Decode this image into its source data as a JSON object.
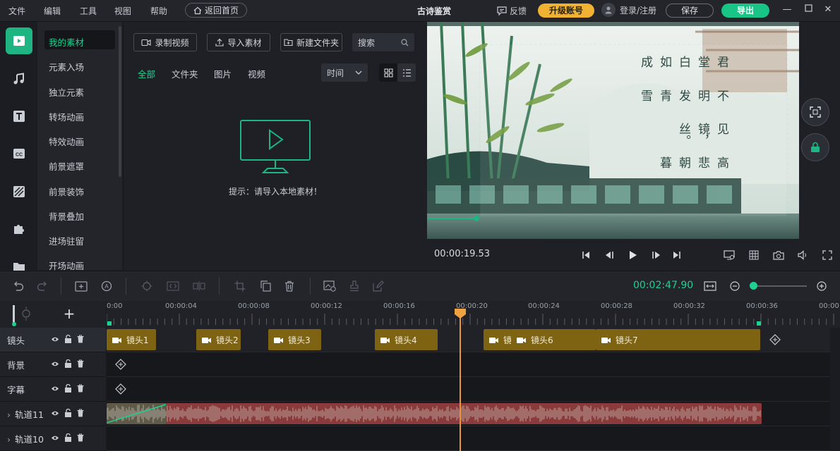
{
  "menu": [
    "文件",
    "编辑",
    "工具",
    "视图",
    "帮助"
  ],
  "home_button": "返回首页",
  "app_title": "古诗鉴赏",
  "feedback": "反馈",
  "upgrade": "升级账号",
  "login": "登录/注册",
  "save": "保存",
  "export": "导出",
  "categories": [
    "我的素材",
    "元素入场",
    "独立元素",
    "转场动画",
    "特效动画",
    "前景遮罩",
    "前景装饰",
    "背景叠加",
    "进场驻留",
    "开场动画"
  ],
  "media_toolbar": {
    "record": "录制视频",
    "import": "导入素材",
    "new_folder": "新建文件夹",
    "search_placeholder": "搜索"
  },
  "filter_tabs": [
    "全部",
    "文件夹",
    "图片",
    "视频"
  ],
  "sort": "时间",
  "empty_hint": "提示：请导入本地素材！",
  "preview": {
    "current_time": "00:00:19.53",
    "poem_columns": [
      "高悲朝暮",
      "见镜，丝。",
      "不明发青雪",
      "君堂白如成"
    ]
  },
  "total_time": "00:02:47.90",
  "ruler_ticks": [
    "0:00",
    "00:00:04",
    "00:00:08",
    "00:00:12",
    "00:00:16",
    "00:00:20",
    "00:00:24",
    "00:00:28",
    "00:00:32",
    "00:00:36",
    "00:00:"
  ],
  "tracks": [
    "镜头",
    "背景",
    "字幕",
    "轨道11",
    "轨道10"
  ],
  "clips": [
    "镜头1",
    "镜头2",
    "镜头3",
    "镜头4",
    "镜",
    "镜头6",
    "镜头7"
  ],
  "colors": {
    "accent": "#1fb582",
    "export": "#18c486",
    "upgrade": "#f0b233",
    "clip": "#7d6312",
    "audio": "#8a3a3a",
    "playhead": "#e8973a"
  }
}
